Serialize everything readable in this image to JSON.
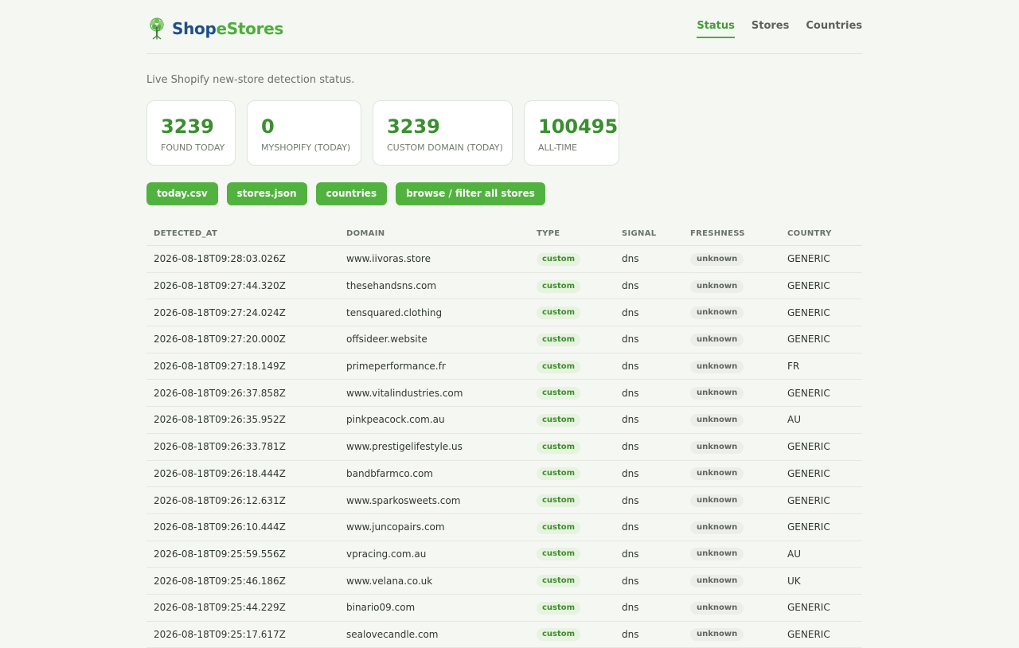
{
  "brand": {
    "part1": "Shop",
    "part2": "eStores",
    "icon": "tree-icon",
    "colors": {
      "primary": "#1f4f8a",
      "accent": "#4caf3a"
    }
  },
  "nav": [
    {
      "label": "Status",
      "active": true
    },
    {
      "label": "Stores",
      "active": false
    },
    {
      "label": "Countries",
      "active": false
    }
  ],
  "subtitle": "Live Shopify new-store detection status.",
  "stats": [
    {
      "value": "3239",
      "label": "FOUND TODAY"
    },
    {
      "value": "0",
      "label": "MYSHOPIFY (TODAY)"
    },
    {
      "value": "3239",
      "label": "CUSTOM DOMAIN (TODAY)"
    },
    {
      "value": "100495",
      "label": "ALL-TIME"
    }
  ],
  "buttons": [
    "today.csv",
    "stores.json",
    "countries",
    "browse / filter all stores"
  ],
  "table": {
    "headers": [
      "DETECTED_AT",
      "DOMAIN",
      "TYPE",
      "SIGNAL",
      "FRESHNESS",
      "COUNTRY"
    ],
    "rows": [
      [
        "2026-08-18T09:28:03.026Z",
        "www.iivoras.store",
        "custom",
        "dns",
        "unknown",
        "GENERIC"
      ],
      [
        "2026-08-18T09:27:44.320Z",
        "thesehandsns.com",
        "custom",
        "dns",
        "unknown",
        "GENERIC"
      ],
      [
        "2026-08-18T09:27:24.024Z",
        "tensquared.clothing",
        "custom",
        "dns",
        "unknown",
        "GENERIC"
      ],
      [
        "2026-08-18T09:27:20.000Z",
        "offsideer.website",
        "custom",
        "dns",
        "unknown",
        "GENERIC"
      ],
      [
        "2026-08-18T09:27:18.149Z",
        "primeperformance.fr",
        "custom",
        "dns",
        "unknown",
        "FR"
      ],
      [
        "2026-08-18T09:26:37.858Z",
        "www.vitalindustries.com",
        "custom",
        "dns",
        "unknown",
        "GENERIC"
      ],
      [
        "2026-08-18T09:26:35.952Z",
        "pinkpeacock.com.au",
        "custom",
        "dns",
        "unknown",
        "AU"
      ],
      [
        "2026-08-18T09:26:33.781Z",
        "www.prestigelifestyle.us",
        "custom",
        "dns",
        "unknown",
        "GENERIC"
      ],
      [
        "2026-08-18T09:26:18.444Z",
        "bandbfarmco.com",
        "custom",
        "dns",
        "unknown",
        "GENERIC"
      ],
      [
        "2026-08-18T09:26:12.631Z",
        "www.sparkosweets.com",
        "custom",
        "dns",
        "unknown",
        "GENERIC"
      ],
      [
        "2026-08-18T09:26:10.444Z",
        "www.juncopairs.com",
        "custom",
        "dns",
        "unknown",
        "GENERIC"
      ],
      [
        "2026-08-18T09:25:59.556Z",
        "vpracing.com.au",
        "custom",
        "dns",
        "unknown",
        "AU"
      ],
      [
        "2026-08-18T09:25:46.186Z",
        "www.velana.co.uk",
        "custom",
        "dns",
        "unknown",
        "UK"
      ],
      [
        "2026-08-18T09:25:44.229Z",
        "binario09.com",
        "custom",
        "dns",
        "unknown",
        "GENERIC"
      ],
      [
        "2026-08-18T09:25:17.617Z",
        "sealovecandle.com",
        "custom",
        "dns",
        "unknown",
        "GENERIC"
      ]
    ]
  }
}
